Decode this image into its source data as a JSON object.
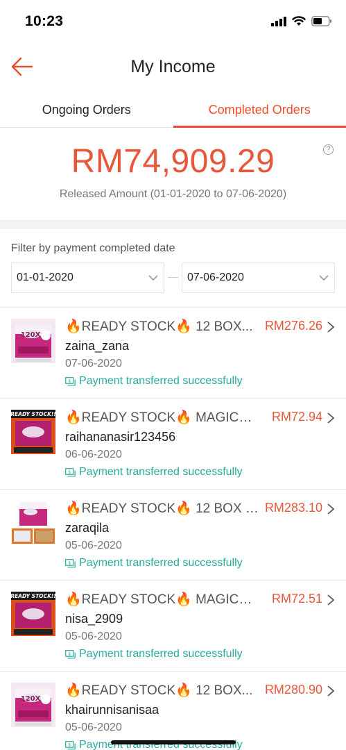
{
  "status_bar": {
    "time": "10:23"
  },
  "header": {
    "title": "My Income"
  },
  "tabs": [
    {
      "label": "Ongoing Orders",
      "active": false
    },
    {
      "label": "Completed Orders",
      "active": true
    }
  ],
  "summary": {
    "amount": "RM74,909.29",
    "released_label": "Released Amount (01-01-2020 to 07-06-2020)",
    "help_icon": "?"
  },
  "filter": {
    "label": "Filter by payment completed date",
    "start_date": "01-01-2020",
    "end_date": "07-06-2020"
  },
  "orders": [
    {
      "title": "🔥READY STOCK🔥 12 BOX...",
      "price": "RM276.26",
      "buyer": "zaina_zana",
      "date": "07-06-2020",
      "status": "Payment transferred successfully",
      "thumb": "box"
    },
    {
      "title": "🔥READY STOCK🔥 MAGICAL...",
      "price": "RM72.94",
      "buyer": "raihananasir123456",
      "date": "06-06-2020",
      "status": "Payment transferred successfully",
      "thumb": "ready"
    },
    {
      "title": "🔥READY STOCK🔥 12 BOX M...",
      "price": "RM283.10",
      "buyer": "zaraqila",
      "date": "05-06-2020",
      "status": "Payment transferred successfully",
      "thumb": "box2"
    },
    {
      "title": "🔥READY STOCK🔥 MAGICAL...",
      "price": "RM72.51",
      "buyer": "nisa_2909",
      "date": "05-06-2020",
      "status": "Payment transferred successfully",
      "thumb": "ready"
    },
    {
      "title": "🔥READY STOCK🔥 12 BOX...",
      "price": "RM280.90",
      "buyer": "khairunnisanisaa",
      "date": "05-06-2020",
      "status": "Payment transferred successfully",
      "thumb": "box"
    }
  ],
  "colors": {
    "accent": "#ee4d2d",
    "price": "#e8573a",
    "success": "#26aa99"
  },
  "icons": {
    "back": "arrow-left-icon",
    "help": "help-icon",
    "dropdown": "chevron-down-icon",
    "row": "chevron-right-icon",
    "payment": "money-transfer-icon"
  }
}
